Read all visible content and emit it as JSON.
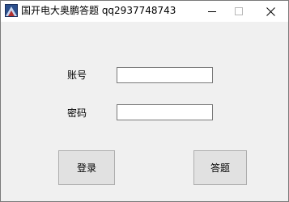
{
  "window": {
    "title": "国开电大奥鹏答题 qq2937748743"
  },
  "form": {
    "account_label": "账号",
    "account_value": "",
    "password_label": "密码",
    "password_value": ""
  },
  "buttons": {
    "login_label": "登录",
    "answer_label": "答题"
  },
  "icons": {
    "app": "app-logo-icon",
    "minimize": "minimize-icon",
    "maximize": "maximize-icon",
    "close": "close-icon"
  },
  "colors": {
    "window_bg": "#f0f0f0",
    "titlebar_bg": "#ffffff",
    "button_bg": "#e1e1e1",
    "button_border": "#adadad",
    "input_border": "#7a7a7a"
  }
}
